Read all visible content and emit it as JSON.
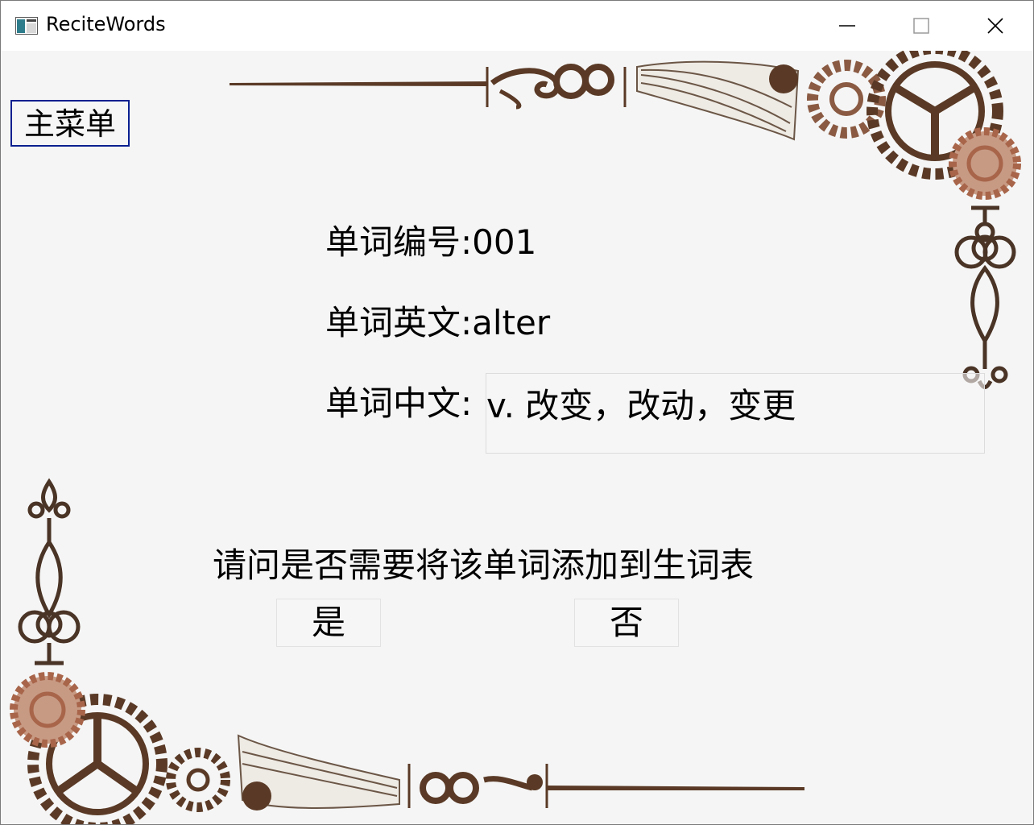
{
  "window": {
    "title": "ReciteWords"
  },
  "menu": {
    "main_menu_label": "主菜单"
  },
  "word": {
    "number_label": "单词编号:001",
    "english_label": "单词英文:alter",
    "chinese_label": "单词中文:",
    "chinese_value": "v. 改变，改动，变更"
  },
  "prompt": {
    "question": "请问是否需要将该单词添加到生词表",
    "yes_label": "是",
    "no_label": "否"
  },
  "icons": {
    "app": "app-icon",
    "minimize": "minimize-icon",
    "maximize": "maximize-icon",
    "close": "close-icon"
  },
  "colors": {
    "ornament": "#5a3a26",
    "gear_copper": "#a8654a",
    "menu_border": "#0a1f8f",
    "background": "#f5f5f5"
  }
}
